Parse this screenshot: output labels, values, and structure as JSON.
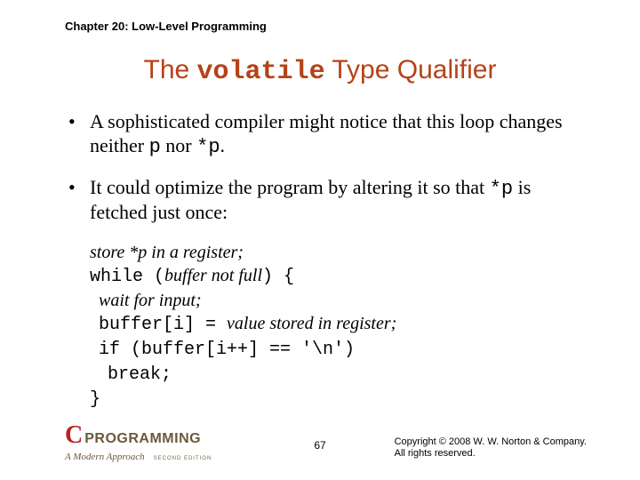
{
  "chapter": "Chapter 20: Low-Level Programming",
  "title": {
    "pre": "The ",
    "kw": "volatile",
    "post": " Type Qualifier"
  },
  "bullets": [
    {
      "parts": [
        {
          "t": "A sophisticated compiler might notice that this loop changes neither "
        },
        {
          "t": "p",
          "mono": true
        },
        {
          "t": " nor "
        },
        {
          "t": "*p",
          "mono": true
        },
        {
          "t": "."
        }
      ]
    },
    {
      "parts": [
        {
          "t": "It could optimize the program by altering it so that "
        },
        {
          "t": "*p",
          "mono": true
        },
        {
          "t": " is fetched just once:"
        }
      ]
    }
  ],
  "code": [
    [
      {
        "t": "store *p in a register",
        "ital": true
      },
      {
        "t": ";",
        "ital": true
      }
    ],
    [
      {
        "t": "while (",
        "mono": true
      },
      {
        "t": "buffer not full",
        "ital": true
      },
      {
        "t": ") {",
        "mono": true
      }
    ],
    [
      {
        "t": "  "
      },
      {
        "t": "wait for input",
        "ital": true
      },
      {
        "t": ";",
        "ital": true
      }
    ],
    [
      {
        "t": "  "
      },
      {
        "t": "buffer[i] = ",
        "mono": true
      },
      {
        "t": "value stored in register",
        "ital": true
      },
      {
        "t": ";",
        "ital": true
      }
    ],
    [
      {
        "t": "  "
      },
      {
        "t": "if (buffer[i++] == '\\n')",
        "mono": true
      }
    ],
    [
      {
        "t": "    "
      },
      {
        "t": "break;",
        "mono": true
      }
    ],
    [
      {
        "t": "}",
        "mono": true
      }
    ]
  ],
  "logo": {
    "c": "C",
    "prog": "PROGRAMMING",
    "sub": "A Modern Approach",
    "ed": "SECOND EDITION"
  },
  "page": "67",
  "copyright": {
    "l1": "Copyright © 2008 W. W. Norton & Company.",
    "l2": "All rights reserved."
  }
}
